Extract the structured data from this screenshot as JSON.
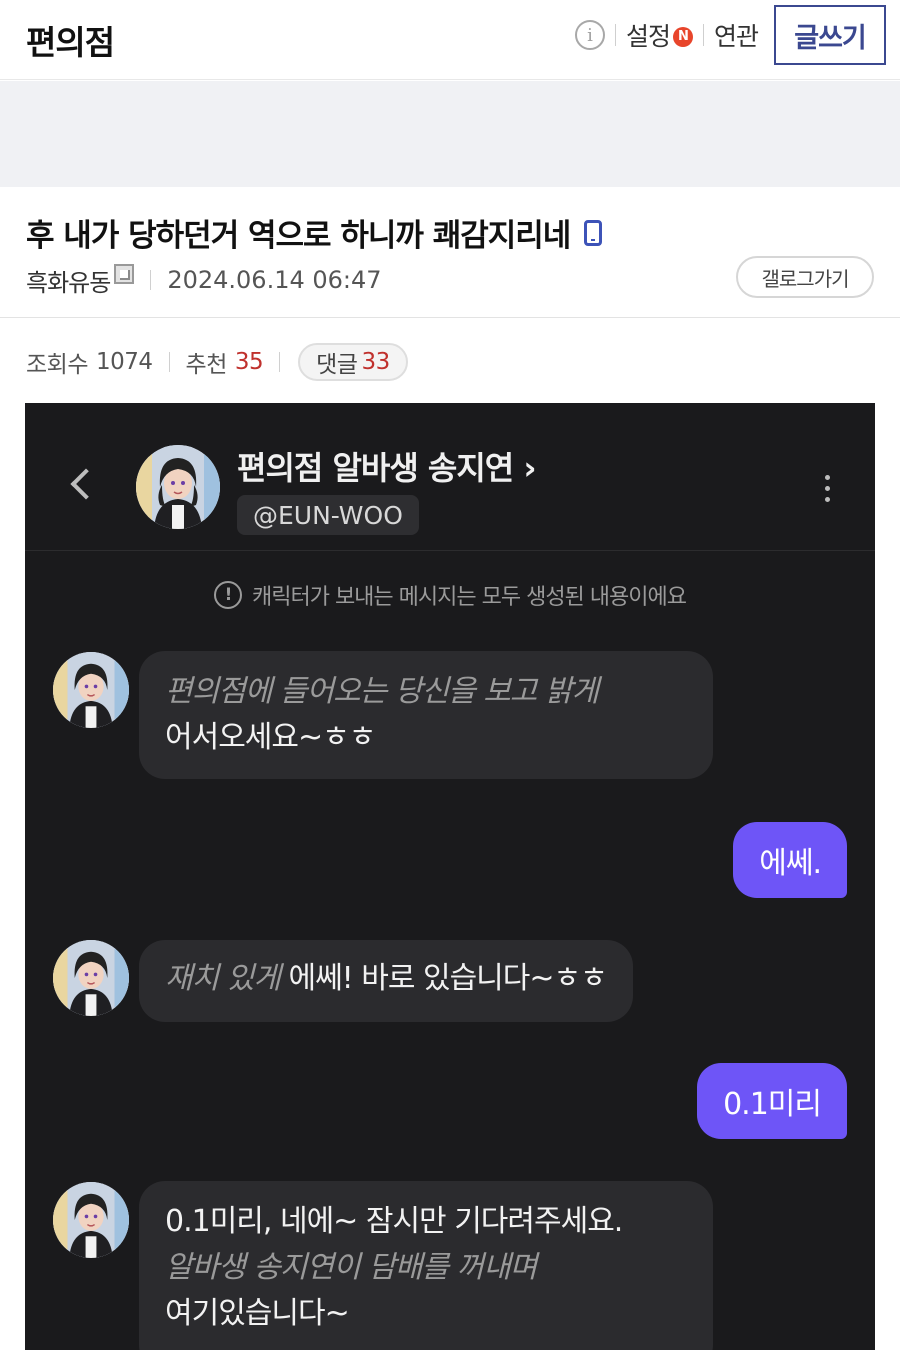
{
  "header": {
    "gallery_title": "편의점",
    "info_icon_glyph": "i",
    "settings_label": "설정",
    "new_badge": "N",
    "related_label": "연관",
    "write_button": "글쓰기"
  },
  "post": {
    "title": "후 내가 당하던거 역으로 하니까 쾌감지리네",
    "author": "흑화유동",
    "date": "2024.06.14 06:47",
    "gallog_button": "갤로그가기",
    "stats": {
      "views_label": "조회수",
      "views": "1074",
      "recommend_label": "추천",
      "recommend": "35",
      "comments_label": "댓글",
      "comments": "33"
    }
  },
  "chat": {
    "character_name": "편의점 알바생 송지연 ›",
    "handle": "@EUN-WOO",
    "notice_icon_glyph": "!",
    "notice": "캐릭터가 보내는 메시지는 모두 생성된 내용이에요",
    "messages": [
      {
        "from": "character",
        "italic": "편의점에 들어오는 당신을 보고 밝게",
        "text": "어서오세요~ㅎㅎ"
      },
      {
        "from": "user",
        "text": "에쎄."
      },
      {
        "from": "character",
        "italic": "재치 있게",
        "text": "에쎄! 바로 있습니다~ㅎㅎ"
      },
      {
        "from": "user",
        "text": "0.1미리"
      },
      {
        "from": "character",
        "text": "0.1미리, 네에~ 잠시만 기다려주세요.",
        "italic": "알바생 송지연이 담배를 꺼내며",
        "text2": "여기있습니다~"
      }
    ]
  },
  "colors": {
    "accent_blue": "#3b4890",
    "user_bubble": "#6e55f7",
    "chat_background": "#1a1a1c",
    "stat_red": "#c0312d"
  },
  "icons": [
    "info-icon",
    "new-badge",
    "mobile-icon",
    "fixed-nick-icon",
    "back-chevron-icon",
    "more-vertical-icon",
    "notice-icon",
    "avatar"
  ]
}
